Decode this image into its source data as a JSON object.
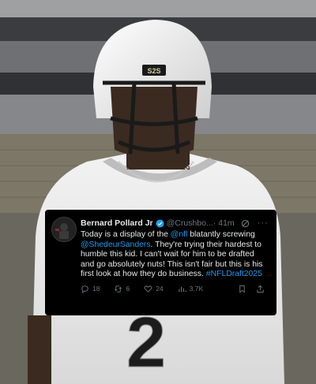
{
  "tweet": {
    "author_name": "Bernard Pollard Jr",
    "handle": "@Crushbo...",
    "separator": "·",
    "time": "41m",
    "more": "···",
    "body_parts": [
      {
        "text": "Today is a display of the ",
        "link": false
      },
      {
        "text": "@nfl",
        "link": true
      },
      {
        "text": " blatantly screwing ",
        "link": false
      },
      {
        "text": "@ShedeurSanders",
        "link": true
      },
      {
        "text": ". They're trying their hardest to humble this kid. I can't wait for him to be drafted and go absolutely nuts! This isn't fair but this is his first look at how they do business. ",
        "link": false
      },
      {
        "text": "#NFLDraft2025",
        "link": true
      }
    ],
    "replies": "18",
    "reposts": "6",
    "likes": "24",
    "views": "3.7K"
  },
  "photo": {
    "helmet_text": "S2S",
    "jersey_number": "2"
  },
  "colors": {
    "link": "#1d9bf0",
    "card_bg": "#000000",
    "muted": "#71767b"
  }
}
